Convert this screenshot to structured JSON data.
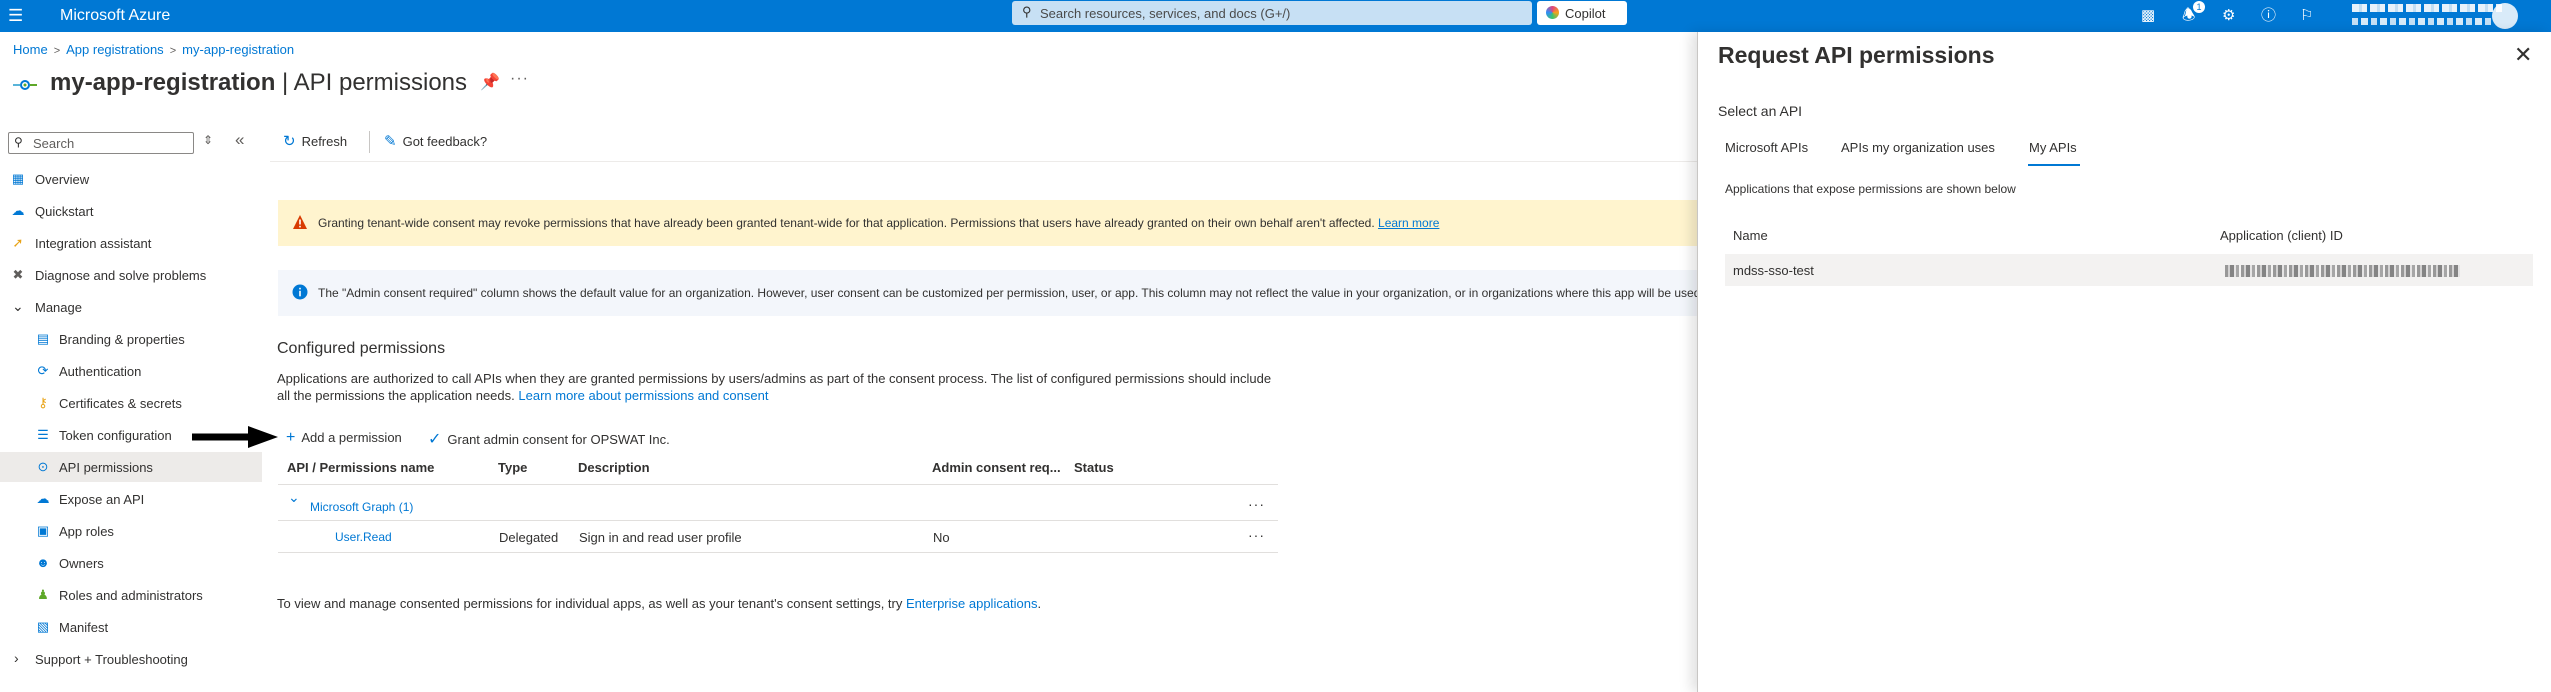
{
  "topbar": {
    "brand": "Microsoft Azure",
    "search_placeholder": "Search resources, services, and docs (G+/)",
    "copilot_label": "Copilot",
    "notification_count": "1"
  },
  "breadcrumb": {
    "items": [
      "Home",
      "App registrations",
      "my-app-registration"
    ]
  },
  "page": {
    "title_app": "my-app-registration",
    "title_section": " | API permissions"
  },
  "nav": {
    "search_placeholder": "Search",
    "items": [
      {
        "label": "Overview",
        "icon": "overview-icon"
      },
      {
        "label": "Quickstart",
        "icon": "quickstart-icon"
      },
      {
        "label": "Integration assistant",
        "icon": "rocket-icon"
      },
      {
        "label": "Diagnose and solve problems",
        "icon": "wrench-icon"
      },
      {
        "label": "Manage",
        "icon": "chevron-down-icon"
      },
      {
        "label": "Branding & properties",
        "icon": "branding-icon"
      },
      {
        "label": "Authentication",
        "icon": "authentication-icon"
      },
      {
        "label": "Certificates & secrets",
        "icon": "key-icon"
      },
      {
        "label": "Token configuration",
        "icon": "token-config-icon"
      },
      {
        "label": "API permissions",
        "icon": "api-permissions-icon"
      },
      {
        "label": "Expose an API",
        "icon": "cloud-icon"
      },
      {
        "label": "App roles",
        "icon": "app-roles-icon"
      },
      {
        "label": "Owners",
        "icon": "owners-icon"
      },
      {
        "label": "Roles and administrators",
        "icon": "roles-icon"
      },
      {
        "label": "Manifest",
        "icon": "manifest-icon"
      },
      {
        "label": "Support + Troubleshooting",
        "icon": "chevron-right-icon"
      }
    ]
  },
  "toolbar": {
    "refresh_label": "Refresh",
    "feedback_label": "Got feedback?"
  },
  "banners": {
    "warning_text": "Granting tenant-wide consent may revoke permissions that have already been granted tenant-wide for that application. Permissions that users have already granted on their own behalf aren't affected.",
    "warning_link": "Learn more",
    "info_text": "The \"Admin consent required\" column shows the default value for an organization. However, user consent can be customized per permission, user, or app. This column may not reflect the value in your organization, or in organizations where this app will be used."
  },
  "configured": {
    "title": "Configured permissions",
    "description": "Applications are authorized to call APIs when they are granted permissions by users/admins as part of the consent process. The list of configured permissions should include all the permissions the application needs.",
    "description_link": "Learn more about permissions and consent",
    "add_permission_label": "Add a permission",
    "grant_consent_label": "Grant admin consent for OPSWAT Inc."
  },
  "table": {
    "headers": [
      "API / Permissions name",
      "Type",
      "Description",
      "Admin consent req...",
      "Status"
    ],
    "group": "Microsoft Graph (1)",
    "rows": [
      {
        "name": "User.Read",
        "type": "Delegated",
        "description": "Sign in and read user profile",
        "admin_consent": "No",
        "status": ""
      }
    ]
  },
  "footer": {
    "text": "To view and manage consented permissions for individual apps, as well as your tenant's consent settings, try",
    "link": "Enterprise applications",
    "end": "."
  },
  "panel": {
    "title": "Request API permissions",
    "select_label": "Select an API",
    "tabs": [
      "Microsoft APIs",
      "APIs my organization uses",
      "My APIs"
    ],
    "active_tab": "My APIs",
    "note": "Applications that expose permissions are shown below",
    "col_name": "Name",
    "col_id": "Application (client) ID",
    "rows": [
      {
        "name": "mdss-sso-test"
      }
    ]
  },
  "colors": {
    "accent": "#0078d4",
    "warning_bg": "#fff4ce",
    "info_bg": "#f3f6fb",
    "selected_nav": "#edebe9"
  }
}
